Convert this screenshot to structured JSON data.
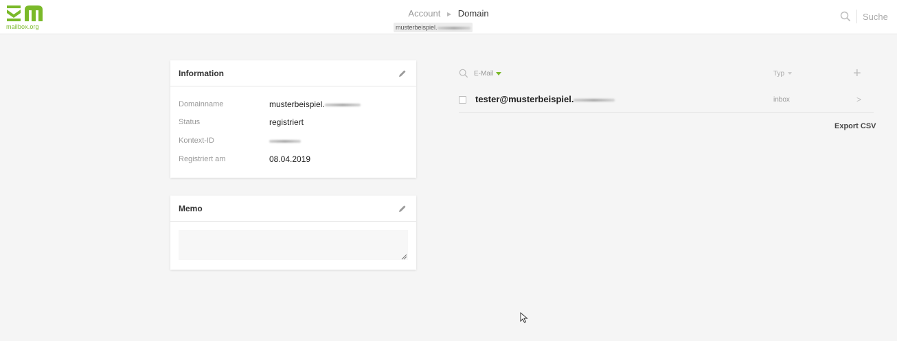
{
  "brand": {
    "name": "mailbox.org",
    "accent": "#7ab929"
  },
  "breadcrumb": {
    "parent": "Account",
    "current": "Domain",
    "subtitle": "musterbeispiel."
  },
  "search": {
    "placeholder": "Suche",
    "icon": "search-icon"
  },
  "info_card": {
    "title": "Information",
    "rows": [
      {
        "label": "Domainname",
        "value": "musterbeispiel."
      },
      {
        "label": "Status",
        "value": "registriert"
      },
      {
        "label": "Kontext-ID",
        "value": ""
      },
      {
        "label": "Registriert am",
        "value": "08.04.2019"
      }
    ]
  },
  "memo_card": {
    "title": "Memo",
    "value": ""
  },
  "list": {
    "columns": {
      "email": "E-Mail",
      "type": "Typ"
    },
    "rows": [
      {
        "email": "tester@musterbeispiel.",
        "type": "inbox"
      }
    ],
    "export_label": "Export CSV"
  }
}
